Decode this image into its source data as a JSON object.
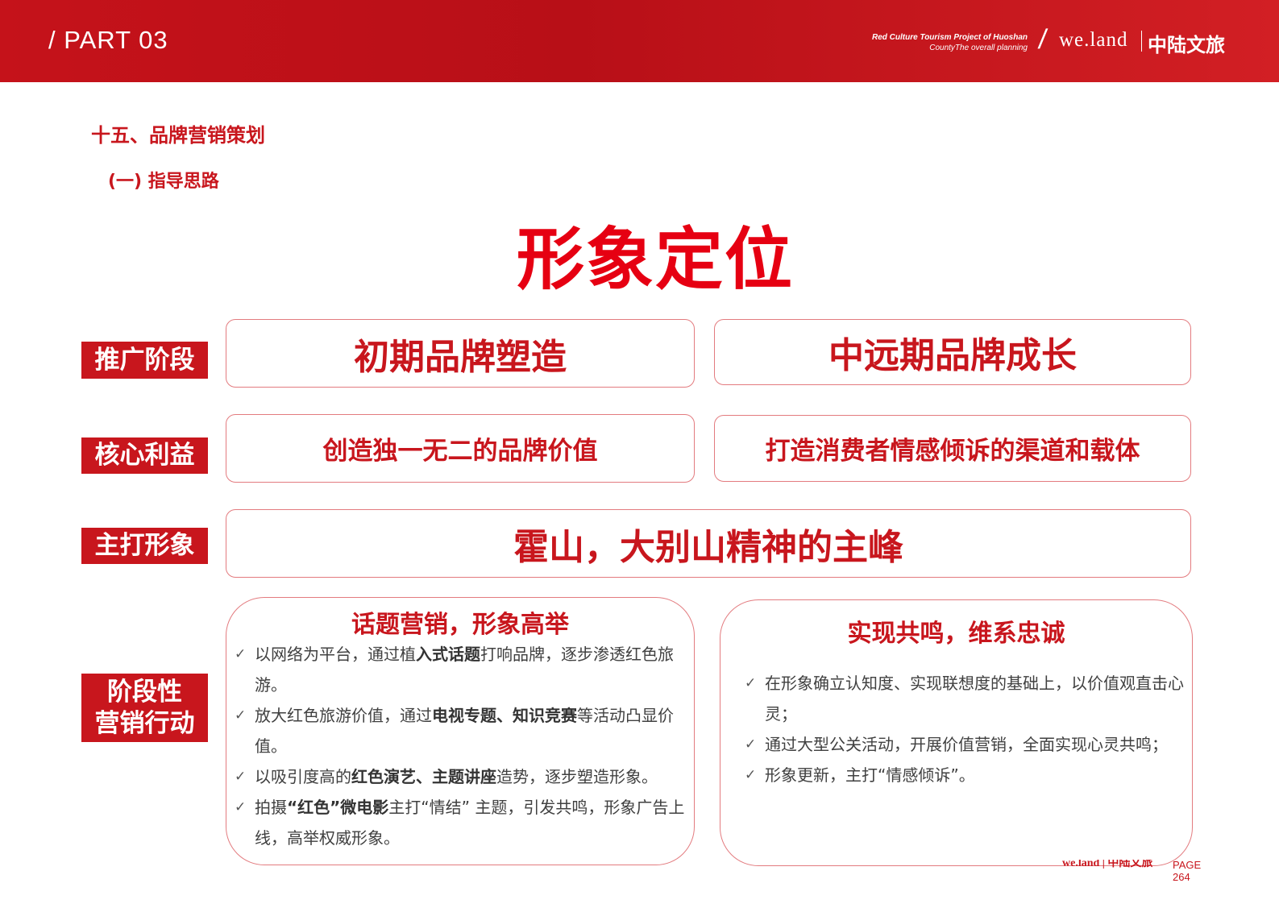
{
  "header": {
    "part_label": "/ PART 03",
    "project_line1": "Red Culture Tourism Project of Huoshan",
    "project_line2": "CountyThe overall planning",
    "slash": "/",
    "brand_logo": "we.land",
    "brand_cn": "中陆文旅"
  },
  "section_title": "十五、品牌营销策划",
  "subsection_title": "(一) 指导思路",
  "main_title": "形象定位",
  "rows": {
    "stage": {
      "label": "推广阶段",
      "early": "初期品牌塑造",
      "mid_long": "中远期品牌成长"
    },
    "core_benefit": {
      "label": "核心利益",
      "early": "创造独一无二的品牌价值",
      "mid_long": "打造消费者情感倾诉的渠道和载体"
    },
    "main_image": {
      "label": "主打形象",
      "value": "霍山，大别山精神的主峰"
    },
    "actions": {
      "label_line1": "阶段性",
      "label_line2": "营销行动",
      "early": {
        "title": "话题营销，形象高举",
        "items": [
          {
            "before": "以网络为平台，通过植",
            "bold": "入式话题",
            "after": "打响品牌，逐步渗透红色旅游。"
          },
          {
            "before": "放大红色旅游价值，通过",
            "bold": "电视专题、知识竞赛",
            "after": "等活动凸显价值。"
          },
          {
            "before": "以吸引度高的",
            "bold": "红色演艺、主题讲座",
            "after": "造势，逐步塑造形象。"
          },
          {
            "before": "拍摄",
            "bold": "“红色”微电影",
            "after": "主打“情结” 主题，引发共鸣，形象广告上线，高举权威形象。"
          }
        ]
      },
      "mid_long": {
        "title": "实现共鸣，维系忠诚",
        "items": [
          "在形象确立认知度、实现联想度的基础上，以价值观直击心灵；",
          "通过大型公关活动，开展价值营销，全面实现心灵共鸣；",
          "形象更新，主打“情感倾诉”。"
        ]
      }
    }
  },
  "footer": {
    "logo": "we.land | 中陆文旅",
    "page_label": "PAGE",
    "page_number": "264"
  },
  "colors": {
    "brand_red": "#c8161d",
    "title_red": "#e60012",
    "border_pink": "#e37b7f"
  },
  "icons": {
    "list_marker": "check-icon"
  }
}
